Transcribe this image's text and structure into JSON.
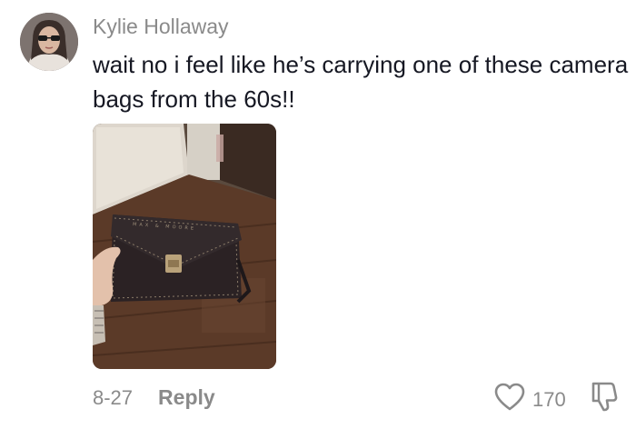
{
  "comment": {
    "username": "Kylie Hollaway",
    "text": "wait no i feel like he’s carrying one of these camera bags from the 60s!!",
    "date": "8-27",
    "reply_label": "Reply",
    "like_count": "170",
    "bag_brand_text": "MAX & MOORE"
  },
  "icons": {
    "like": "heart-outline-icon",
    "dislike": "thumbs-down-outline-icon"
  },
  "colors": {
    "username": "#8a8a8a",
    "text": "#161823",
    "meta": "#8a8a8a"
  }
}
